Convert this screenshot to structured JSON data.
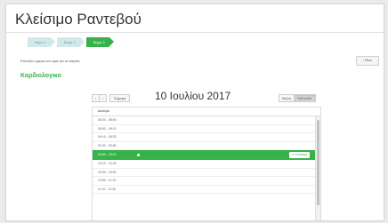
{
  "page": {
    "title": "Κλείσιμο Ραντεβού",
    "instruction": "Επιλέξτε ημέρα και ώρα για το ιατρείο",
    "specialty": "Καρδιολογικο",
    "back_label": "‹ Πίσω"
  },
  "steps": [
    {
      "label": "Βήμα 1",
      "active": false
    },
    {
      "label": "Βήμα 2",
      "active": false
    },
    {
      "label": "Βήμα 3",
      "active": true
    }
  ],
  "calendar": {
    "prev_label": "‹",
    "next_label": "›",
    "today_label": "Σήμερα",
    "date_title": "10 Ιουλίου 2017",
    "view_buttons": [
      {
        "label": "Μήνας",
        "active": false
      },
      {
        "label": "Εβδομάδα",
        "active": true
      }
    ],
    "day_header": "Δευτέρα",
    "slots": [
      {
        "time": "08:30 - 08:50",
        "selected": false
      },
      {
        "time": "08:50 - 09:10",
        "selected": false
      },
      {
        "time": "09:10 - 09:30",
        "selected": false
      },
      {
        "time": "09:30 - 09:50",
        "selected": false
      },
      {
        "time": "09:50 - 10:10",
        "selected": true
      },
      {
        "time": "10:10 - 10:30",
        "selected": false
      },
      {
        "time": "10:30 - 10:50",
        "selected": false
      },
      {
        "time": "10:50 - 11:10",
        "selected": false
      },
      {
        "time": "11:10 - 11:30",
        "selected": false
      }
    ],
    "select_label": "✔ Επιλογή"
  },
  "colors": {
    "accent": "#37b24a",
    "step_inactive": "#d3e8ea"
  }
}
